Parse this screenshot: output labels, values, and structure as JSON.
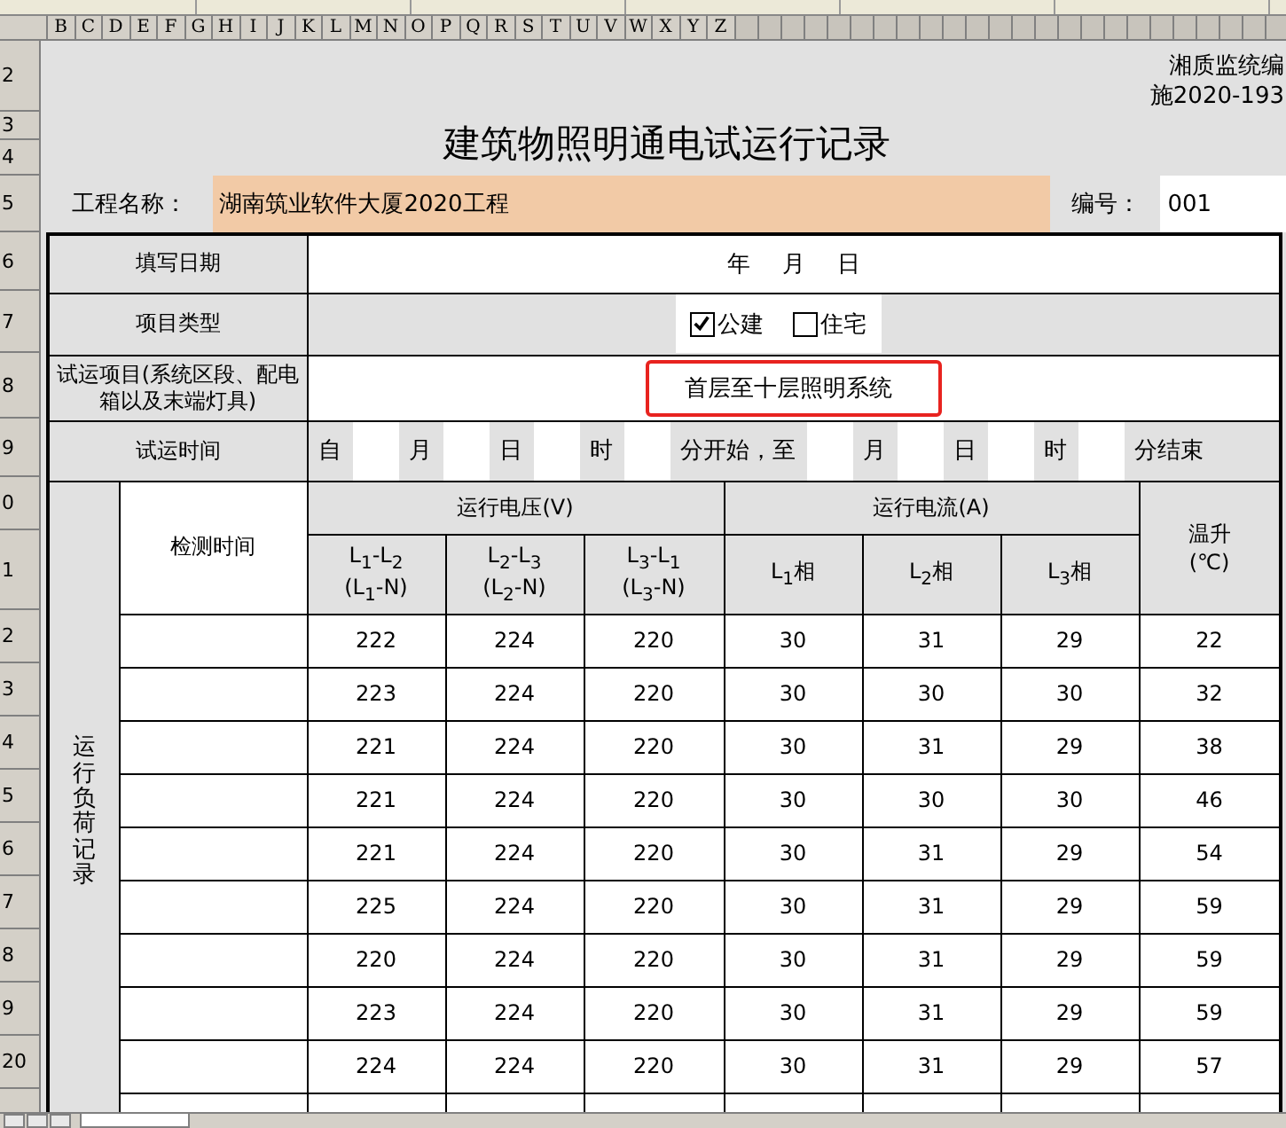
{
  "column_headers": [
    "B",
    "C",
    "D",
    "E",
    "F",
    "G",
    "H",
    "I",
    "J",
    "K",
    "L",
    "M",
    "N",
    "O",
    "P",
    "Q",
    "R",
    "S",
    "T",
    "U",
    "V",
    "W",
    "X",
    "Y",
    "Z"
  ],
  "row_numbers": [
    "2",
    "3",
    "4",
    "5",
    "6",
    "7",
    "8",
    "9",
    "0",
    "1",
    "2",
    "3",
    "4",
    "5",
    "6",
    "7",
    "8",
    "9",
    "20"
  ],
  "header": {
    "code_line1": "湘质监统编",
    "code_line2": "施2020-193",
    "title": "建筑物照明通电试运行记录",
    "project_label": "工程名称：",
    "project_name": "湖南筑业软件大厦2020工程",
    "number_label": "编号：",
    "number": "001"
  },
  "form": {
    "date_label": "填写日期",
    "date_parts": [
      "年",
      "月",
      "日"
    ],
    "type_label": "项目类型",
    "type_options": [
      {
        "label": "公建",
        "checked": true
      },
      {
        "label": "住宅",
        "checked": false
      }
    ],
    "item_label": "试运项目(系统区段、配电箱以及末端灯具)",
    "item_value": "首层至十层照明系统",
    "item_highlighted": true,
    "time_label": "试运时间",
    "time_parts": [
      "自",
      "月",
      "日",
      "时",
      "分开始，至",
      "月",
      "日",
      "时",
      "分结束"
    ]
  },
  "table": {
    "side_label": "运行负荷记录",
    "time_header": "检测时间",
    "voltage_header": "运行电压(V)",
    "current_header": "运行电流(A)",
    "temp_header": "温升",
    "temp_unit": "(℃)",
    "voltage_columns": [
      {
        "top": "L$_{1}$-L$_{2}$",
        "bottom": "(L$_{1}$-N)"
      },
      {
        "top": "L$_{2}$-L$_{3}$",
        "bottom": "(L$_{2}$-N)"
      },
      {
        "top": "L$_{3}$-L$_{1}$",
        "bottom": "(L$_{3}$-N)"
      }
    ],
    "current_columns": [
      "L$_{1}$相",
      "L$_{2}$相",
      "L$_{3}$相"
    ],
    "rows": [
      [
        "222",
        "224",
        "220",
        "30",
        "31",
        "29",
        "22"
      ],
      [
        "223",
        "224",
        "220",
        "30",
        "30",
        "30",
        "32"
      ],
      [
        "221",
        "224",
        "220",
        "30",
        "31",
        "29",
        "38"
      ],
      [
        "221",
        "224",
        "220",
        "30",
        "30",
        "30",
        "46"
      ],
      [
        "221",
        "224",
        "220",
        "30",
        "31",
        "29",
        "54"
      ],
      [
        "225",
        "224",
        "220",
        "30",
        "31",
        "29",
        "59"
      ],
      [
        "220",
        "224",
        "220",
        "30",
        "31",
        "29",
        "59"
      ],
      [
        "223",
        "224",
        "220",
        "30",
        "31",
        "29",
        "59"
      ],
      [
        "224",
        "224",
        "220",
        "30",
        "31",
        "29",
        "57"
      ]
    ]
  }
}
